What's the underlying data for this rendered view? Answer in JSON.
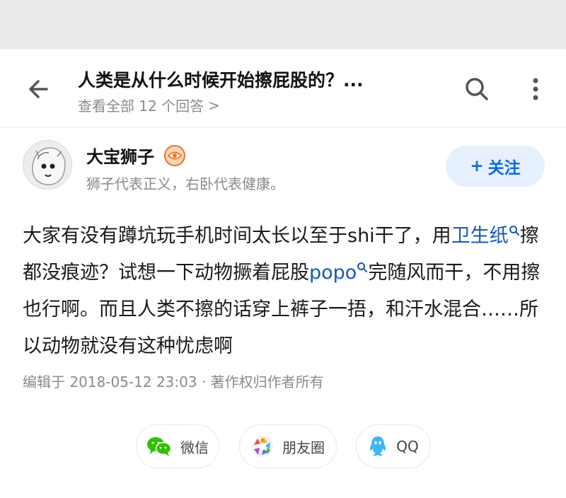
{
  "header": {
    "title": "人类是从什么时候开始擦屁股的？...",
    "subtitle": "查看全部 12 个回答",
    "subtitle_arrow": ">"
  },
  "author": {
    "name": "大宝狮子",
    "bio": "狮子代表正义，右卧代表健康。",
    "follow_label": "关注",
    "follow_plus": "+"
  },
  "answer": {
    "text_1": "大家有没有蹲坑玩手机时间太长以至于shi干了，用",
    "keyword_1": "卫生纸",
    "text_2": "擦都没痕迹？试想一下动物撅着屁股",
    "keyword_2": "popo",
    "text_3": "完随风而干，不用擦也行啊。而且人类不擦的话穿上裤子一捂，和汗水混合……所以动物就没有这种忧虑啊"
  },
  "meta": {
    "edited": "编辑于 2018-05-12 23:03",
    "separator": "·",
    "copyright": "著作权归作者所有"
  },
  "share": {
    "wechat": "微信",
    "moments": "朋友圈",
    "qq": "QQ"
  },
  "colors": {
    "link": "#1559b8",
    "follow_bg": "#e7f0fd",
    "follow_text": "#0f66e0",
    "secondary_text": "#8a8a8a",
    "wechat_green": "#2dc100",
    "qq_blue": "#3eb6f5"
  },
  "icons": {
    "back": "back-arrow-icon",
    "search": "search-icon",
    "more": "more-vertical-icon",
    "badge": "eye-badge-icon",
    "keyword_search": "search-icon",
    "wechat": "wechat-icon",
    "moments": "moments-icon",
    "qq": "qq-icon"
  }
}
